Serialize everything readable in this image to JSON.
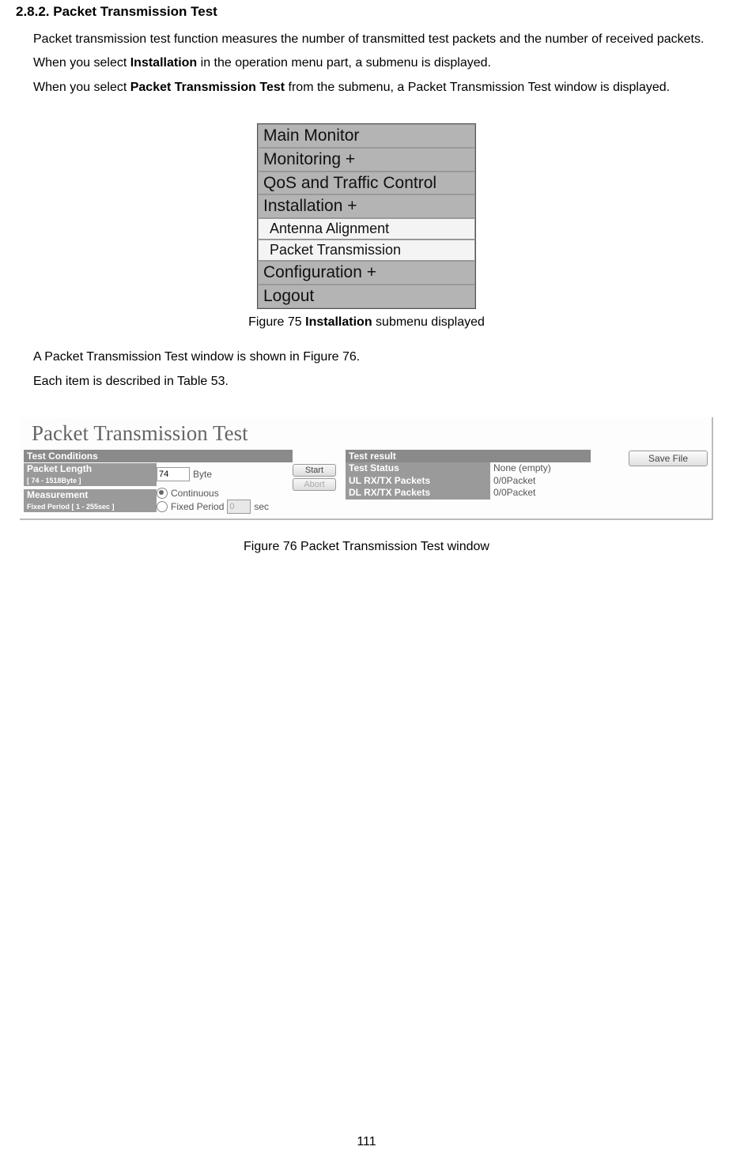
{
  "heading": "2.8.2. Packet Transmission Test",
  "para1_a": "Packet transmission test function measures the number of transmitted test packets and the number of received packets.",
  "para2_a": "When you select ",
  "para2_b": "Installation",
  "para2_c": " in the operation menu part, a submenu is displayed.",
  "para3_a": "When you select ",
  "para3_b": "Packet Transmission Test",
  "para3_c": " from the submenu, a Packet Transmission Test window is displayed.",
  "caption1_a": "Figure 75 ",
  "caption1_b": "Installation",
  "caption1_c": " submenu displayed",
  "para4": "A Packet Transmission Test window is shown in Figure 76.",
  "para5": "Each item is described in Table 53.",
  "caption2": "Figure 76 Packet Transmission Test window",
  "page_number": "111",
  "menu": {
    "main_monitor": "Main Monitor",
    "monitoring": "Monitoring +",
    "qos": "QoS and Traffic Control",
    "installation": "Installation +",
    "antenna": "Antenna Alignment",
    "packet_trans": "Packet Transmission",
    "configuration": "Configuration +",
    "logout": "Logout"
  },
  "test_window": {
    "title": "Packet Transmission Test",
    "conditions_header": "Test Conditions",
    "packet_length_label": "Packet Length",
    "packet_length_range": "[ 74 - 1518Byte ]",
    "packet_length_value": "74",
    "packet_length_unit": "Byte",
    "measurement_label": "Measurement",
    "measurement_range": "Fixed Period [ 1 - 255sec ]",
    "continuous": "Continuous",
    "fixed_period": "Fixed Period",
    "fixed_value": "0",
    "fixed_unit": "sec",
    "start_btn": "Start",
    "abort_btn": "Abort",
    "result_header": "Test result",
    "test_status_label": "Test Status",
    "test_status_value": "None (empty)",
    "ul_label": "UL RX/TX Packets",
    "ul_value": "0/0Packet",
    "dl_label": "DL RX/TX Packets",
    "dl_value": "0/0Packet",
    "save_file": "Save File"
  },
  "chart_data": {
    "type": "table",
    "title": "Packet Transmission Test - Test Conditions and Results",
    "conditions": {
      "Packet Length": {
        "value": 74,
        "unit": "Byte",
        "range": "74 - 1518"
      },
      "Measurement": {
        "mode": "Continuous",
        "fixed_period_sec": 0,
        "range_sec": "1 - 255"
      }
    },
    "results": {
      "Test Status": "None (empty)",
      "UL RX/TX Packets": "0/0Packet",
      "DL RX/TX Packets": "0/0Packet"
    }
  }
}
